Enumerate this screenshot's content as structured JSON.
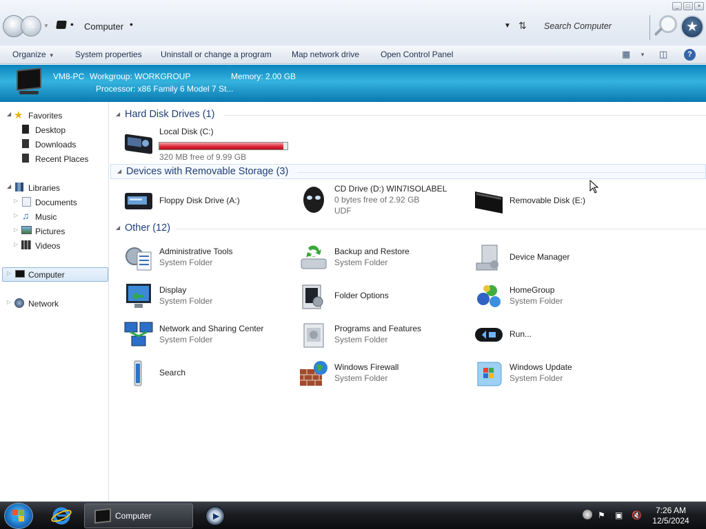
{
  "window": {
    "address": "Computer",
    "search_placeholder": "Search Computer"
  },
  "toolbar": {
    "organize": "Organize",
    "system_properties": "System properties",
    "uninstall": "Uninstall or change a program",
    "map_drive": "Map network drive",
    "control_panel": "Open Control Panel"
  },
  "info": {
    "pc_name": "VM8-PC",
    "workgroup": "Workgroup: WORKGROUP",
    "memory": "Memory: 2.00 GB",
    "processor": "Processor: x86 Family 6 Model 7 St..."
  },
  "nav": {
    "favorites": "Favorites",
    "desktop": "Desktop",
    "downloads": "Downloads",
    "recent_places": "Recent Places",
    "libraries": "Libraries",
    "documents": "Documents",
    "music": "Music",
    "pictures": "Pictures",
    "videos": "Videos",
    "computer": "Computer",
    "network": "Network"
  },
  "groups": {
    "hdd": "Hard Disk Drives (1)",
    "removable": "Devices with Removable Storage (3)",
    "other": "Other (12)"
  },
  "drives": {
    "local_disk": {
      "name": "Local Disk (C:)",
      "free": "320 MB free of 9.99 GB",
      "used_fraction": 0.97
    },
    "floppy": {
      "name": "Floppy Disk Drive (A:)"
    },
    "cd": {
      "name": "CD Drive (D:) WIN7ISOLABEL",
      "free": "0 bytes free of 2.92 GB",
      "fs": "UDF"
    },
    "removable": {
      "name": "Removable Disk (E:)"
    }
  },
  "other_items": {
    "admin_tools": {
      "name": "Administrative Tools",
      "type": "System Folder"
    },
    "backup": {
      "name": "Backup and Restore",
      "type": "System Folder"
    },
    "device_manager": {
      "name": "Device Manager"
    },
    "display": {
      "name": "Display",
      "type": "System Folder"
    },
    "folder_options": {
      "name": "Folder Options"
    },
    "homegroup": {
      "name": "HomeGroup",
      "type": "System Folder"
    },
    "network_sharing": {
      "name": "Network and Sharing Center",
      "type": "System Folder"
    },
    "programs": {
      "name": "Programs and Features",
      "type": "System Folder"
    },
    "run": {
      "name": "Run..."
    },
    "search": {
      "name": "Search"
    },
    "firewall": {
      "name": "Windows Firewall",
      "type": "System Folder"
    },
    "update": {
      "name": "Windows Update",
      "type": "System Folder"
    }
  },
  "taskbar": {
    "computer_task": "Computer",
    "time": "7:26 AM",
    "date": "12/5/2024"
  },
  "colors": {
    "accent": "#1e3e78",
    "banner": "#1a9bd0",
    "disk_bar": "#da2533"
  }
}
